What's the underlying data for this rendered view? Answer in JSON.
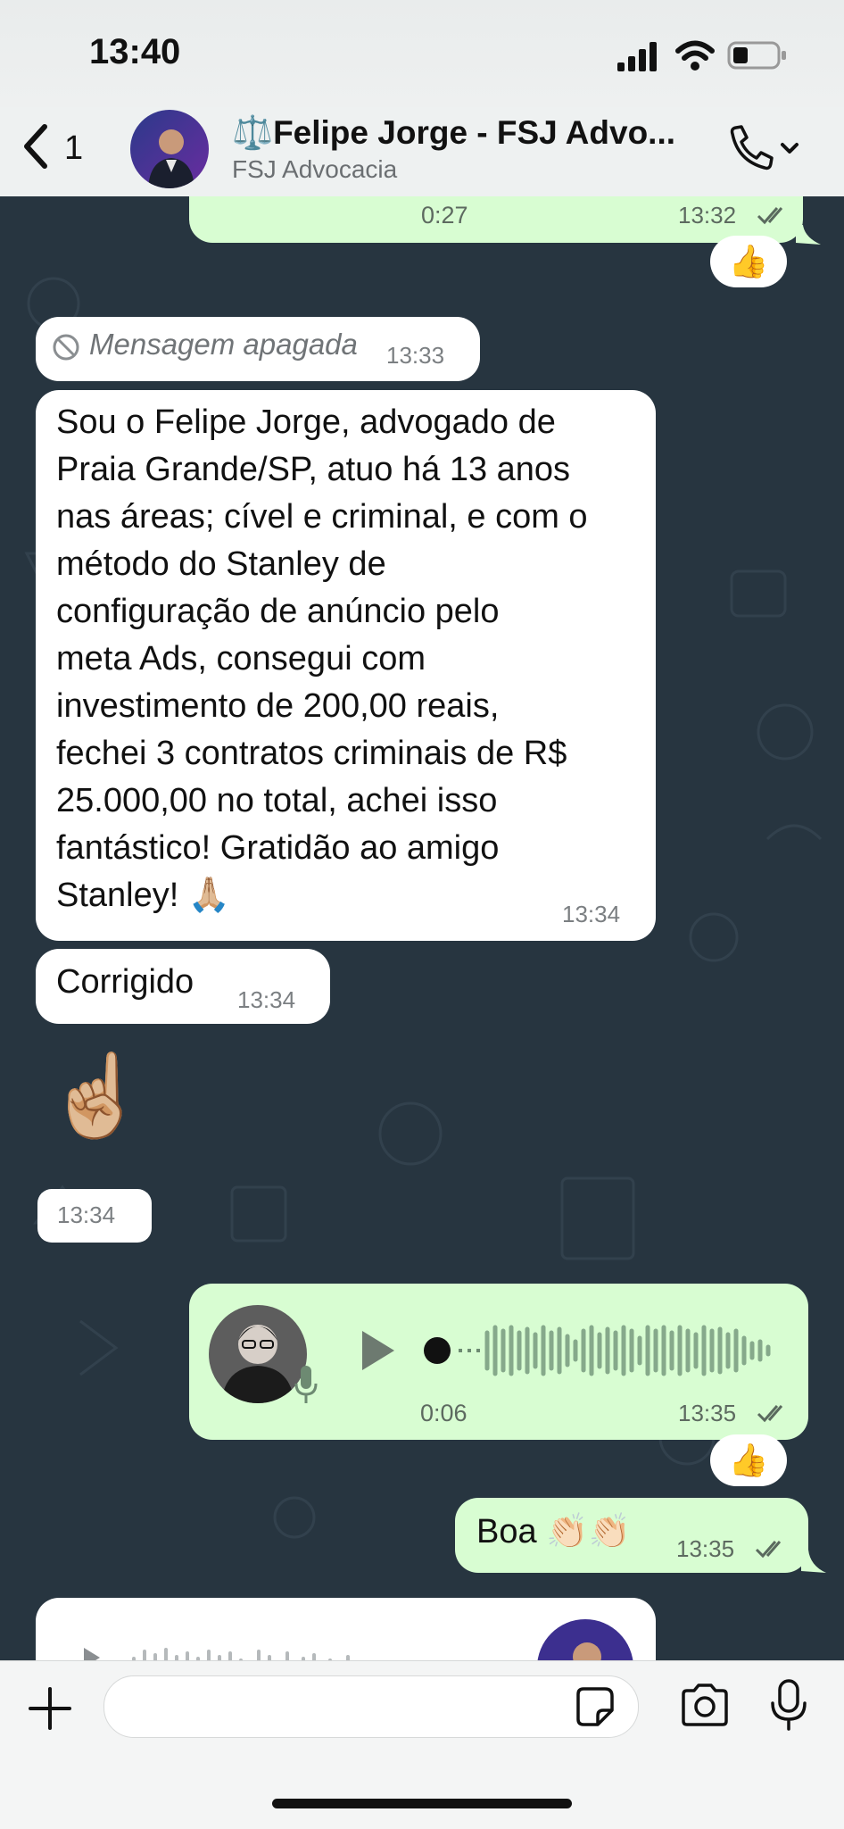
{
  "status_bar": {
    "time": "13:40"
  },
  "header": {
    "back_count": "1",
    "contact_name": "⚖️Felipe Jorge - FSJ Advo...",
    "contact_subtitle": "FSJ Advocacia"
  },
  "messages": {
    "voice_prev": {
      "duration": "0:27",
      "time": "13:32",
      "reaction": "👍"
    },
    "deleted": {
      "text": "Mensagem apagada",
      "time": "13:33"
    },
    "long_text": {
      "lines": [
        "Sou o Felipe Jorge, advogado de",
        "Praia Grande/SP, atuo há 13 anos",
        "nas áreas; cível e criminal, e com o",
        "método do Stanley de",
        "configuração de anúncio pelo",
        "meta Ads, consegui com",
        "investimento de 200,00 reais,",
        "fechei 3 contratos criminais de R$",
        "25.000,00 no total, achei isso",
        "fantástico! Gratidão ao amigo",
        "Stanley! 🙏🏼"
      ],
      "time": "13:34"
    },
    "corrigido": {
      "text": "Corrigido",
      "time": "13:34"
    },
    "emoji_msg": {
      "emoji": "☝🏼",
      "time": "13:34"
    },
    "voice_out": {
      "duration": "0:06",
      "time": "13:35",
      "reaction": "👍"
    },
    "boa": {
      "text": "Boa 👏🏻👏🏻",
      "time": "13:35"
    }
  },
  "colors": {
    "chat_bg": "#273540",
    "out_bubble": "#d8fdd2",
    "in_bubble": "#ffffff",
    "read_ticks": "#555555"
  }
}
